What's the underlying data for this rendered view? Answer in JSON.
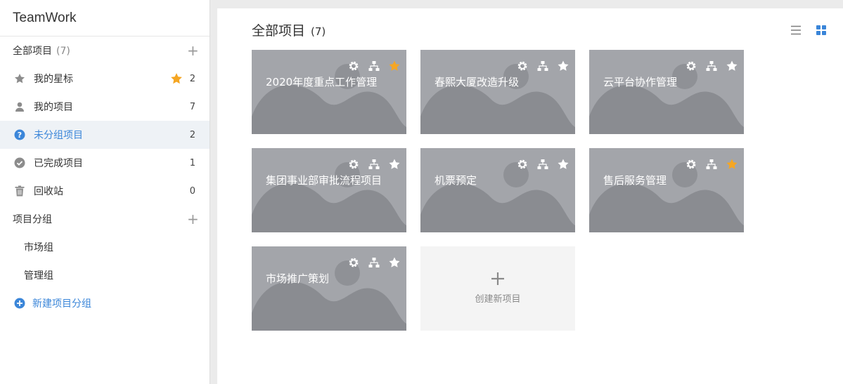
{
  "app": {
    "title": "TeamWork"
  },
  "sidebar": {
    "all": {
      "label": "全部项目",
      "count": "(7)"
    },
    "items": [
      {
        "label": "我的星标",
        "count": "2"
      },
      {
        "label": "我的项目",
        "count": "7"
      },
      {
        "label": "未分组项目",
        "count": "2"
      },
      {
        "label": "已完成项目",
        "count": "1"
      },
      {
        "label": "回收站",
        "count": "0"
      }
    ],
    "groups_title": "项目分组",
    "groups": [
      {
        "label": "市场组"
      },
      {
        "label": "管理组"
      }
    ],
    "new_group": "新建项目分组"
  },
  "main": {
    "title": "全部项目",
    "count": "(7)",
    "projects": [
      {
        "name": "2020年度重点工作管理",
        "starred": true
      },
      {
        "name": "春熙大厦改造升级",
        "starred": false
      },
      {
        "name": "云平台协作管理",
        "starred": false
      },
      {
        "name": "集团事业部审批流程项目",
        "starred": false
      },
      {
        "name": "机票预定",
        "starred": false
      },
      {
        "name": "售后服务管理",
        "starred": true
      },
      {
        "name": "市场推广策划",
        "starred": false
      }
    ],
    "new_project": "创建新项目"
  },
  "colors": {
    "accent": "#3b86d9",
    "star_active": "#f5a623",
    "card_bg": "#a3a5aa"
  }
}
